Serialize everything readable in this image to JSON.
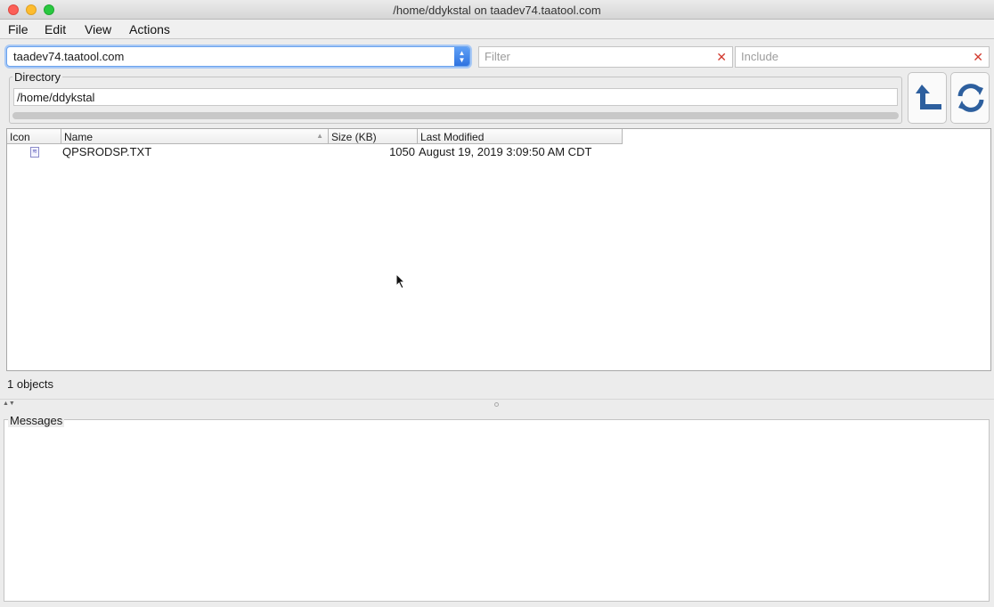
{
  "window": {
    "title": "/home/ddykstal on taadev74.taatool.com"
  },
  "menu": [
    "File",
    "Edit",
    "View",
    "Actions"
  ],
  "toolbar": {
    "host_value": "taadev74.taatool.com",
    "filter_placeholder": "Filter",
    "include_placeholder": "Include",
    "clear_glyph": "✕"
  },
  "directory": {
    "legend": "Directory",
    "path": "/home/ddykstal"
  },
  "table": {
    "columns": [
      "Icon",
      "Name",
      "Size (KB)",
      "Last Modified"
    ],
    "rows": [
      {
        "name": "QPSRODSP.TXT",
        "size": "1050",
        "modified": "August 19, 2019 3:09:50 AM CDT"
      }
    ]
  },
  "status": {
    "count_text": "1 objects"
  },
  "messages": {
    "legend": "Messages"
  },
  "colors": {
    "accent": "#2f73e0",
    "icon_blue": "#2d5f9e",
    "clear_red": "#d23a2f"
  }
}
